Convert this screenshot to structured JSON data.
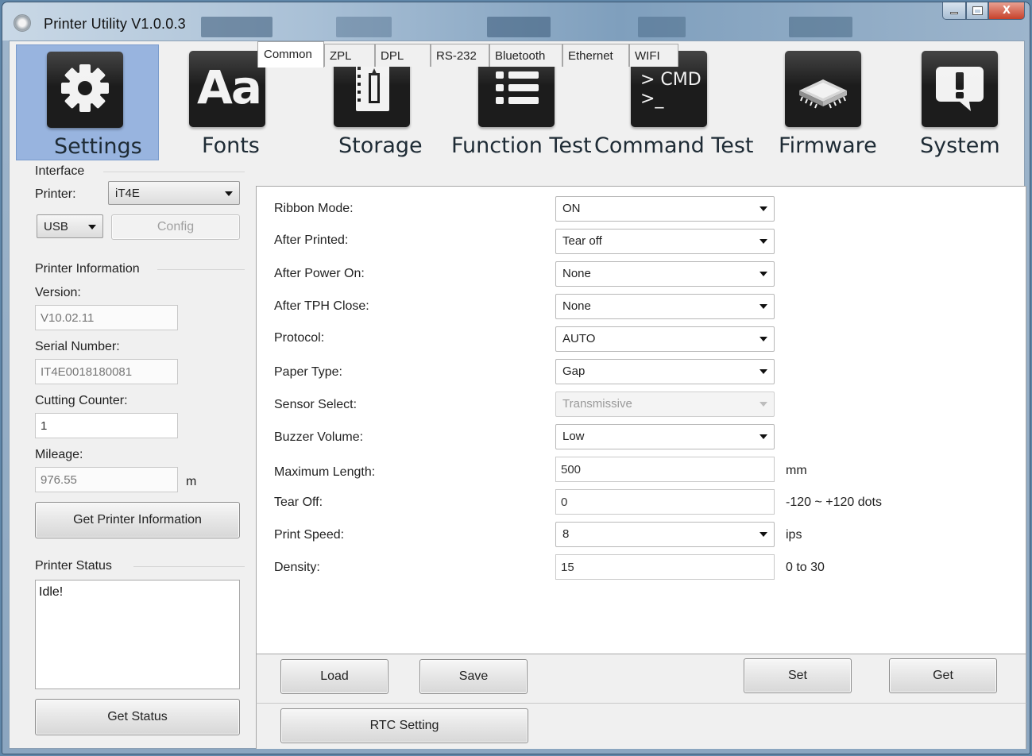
{
  "window": {
    "title": "Printer Utility  V1.0.0.3",
    "close_glyph": "X"
  },
  "toolbar": {
    "items": [
      {
        "label": "Settings",
        "icon": "gear-icon",
        "active": true
      },
      {
        "label": "Fonts",
        "icon": "fonts-icon",
        "icon_text": "Aa"
      },
      {
        "label": "Storage",
        "icon": "storage-icon"
      },
      {
        "label": "Function Test",
        "icon": "list-icon"
      },
      {
        "label": "Command Test",
        "icon": "terminal-icon",
        "icon_text_1": "> CMD",
        "icon_text_2": ">_"
      },
      {
        "label": "Firmware",
        "icon": "chip-icon"
      },
      {
        "label": "System",
        "icon": "alert-bubble-icon"
      }
    ]
  },
  "left": {
    "interface_title": "Interface",
    "printer_label": "Printer:",
    "printer_value": "iT4E",
    "port_value": "USB",
    "config_label": "Config",
    "info_title": "Printer Information",
    "version_label": "Version:",
    "version_value": "V10.02.11",
    "serial_label": "Serial Number:",
    "serial_value": "IT4E0018180081",
    "cutting_label": "Cutting Counter:",
    "cutting_value": "1",
    "mileage_label": "Mileage:",
    "mileage_value": "976.55",
    "mileage_unit": "m",
    "get_info_label": "Get Printer Information",
    "status_title": "Printer Status",
    "status_text": "Idle!",
    "get_status_label": "Get Status"
  },
  "tabs": [
    "Common",
    "ZPL",
    "DPL",
    "RS-232",
    "Bluetooth",
    "Ethernet",
    "WIFI"
  ],
  "settings": {
    "ribbon_mode": {
      "label": "Ribbon Mode:",
      "value": "ON"
    },
    "after_printed": {
      "label": "After Printed:",
      "value": "Tear off"
    },
    "after_power_on": {
      "label": "After Power On:",
      "value": "None"
    },
    "after_tph_close": {
      "label": "After TPH Close:",
      "value": "None"
    },
    "protocol": {
      "label": "Protocol:",
      "value": "AUTO"
    },
    "paper_type": {
      "label": "Paper Type:",
      "value": "Gap"
    },
    "sensor_select": {
      "label": "Sensor Select:",
      "value": "Transmissive"
    },
    "buzzer_volume": {
      "label": "Buzzer Volume:",
      "value": "Low"
    },
    "maximum_length": {
      "label": "Maximum Length:",
      "value": "500",
      "unit": "mm"
    },
    "tear_off": {
      "label": "Tear Off:",
      "value": "0",
      "unit": "-120 ~ +120 dots"
    },
    "print_speed": {
      "label": "Print Speed:",
      "value": "8",
      "unit": "ips"
    },
    "density": {
      "label": "Density:",
      "value": "15",
      "unit": "0 to 30"
    }
  },
  "actions": {
    "load": "Load",
    "save": "Save",
    "set": "Set",
    "get": "Get",
    "rtc": "RTC Setting"
  }
}
